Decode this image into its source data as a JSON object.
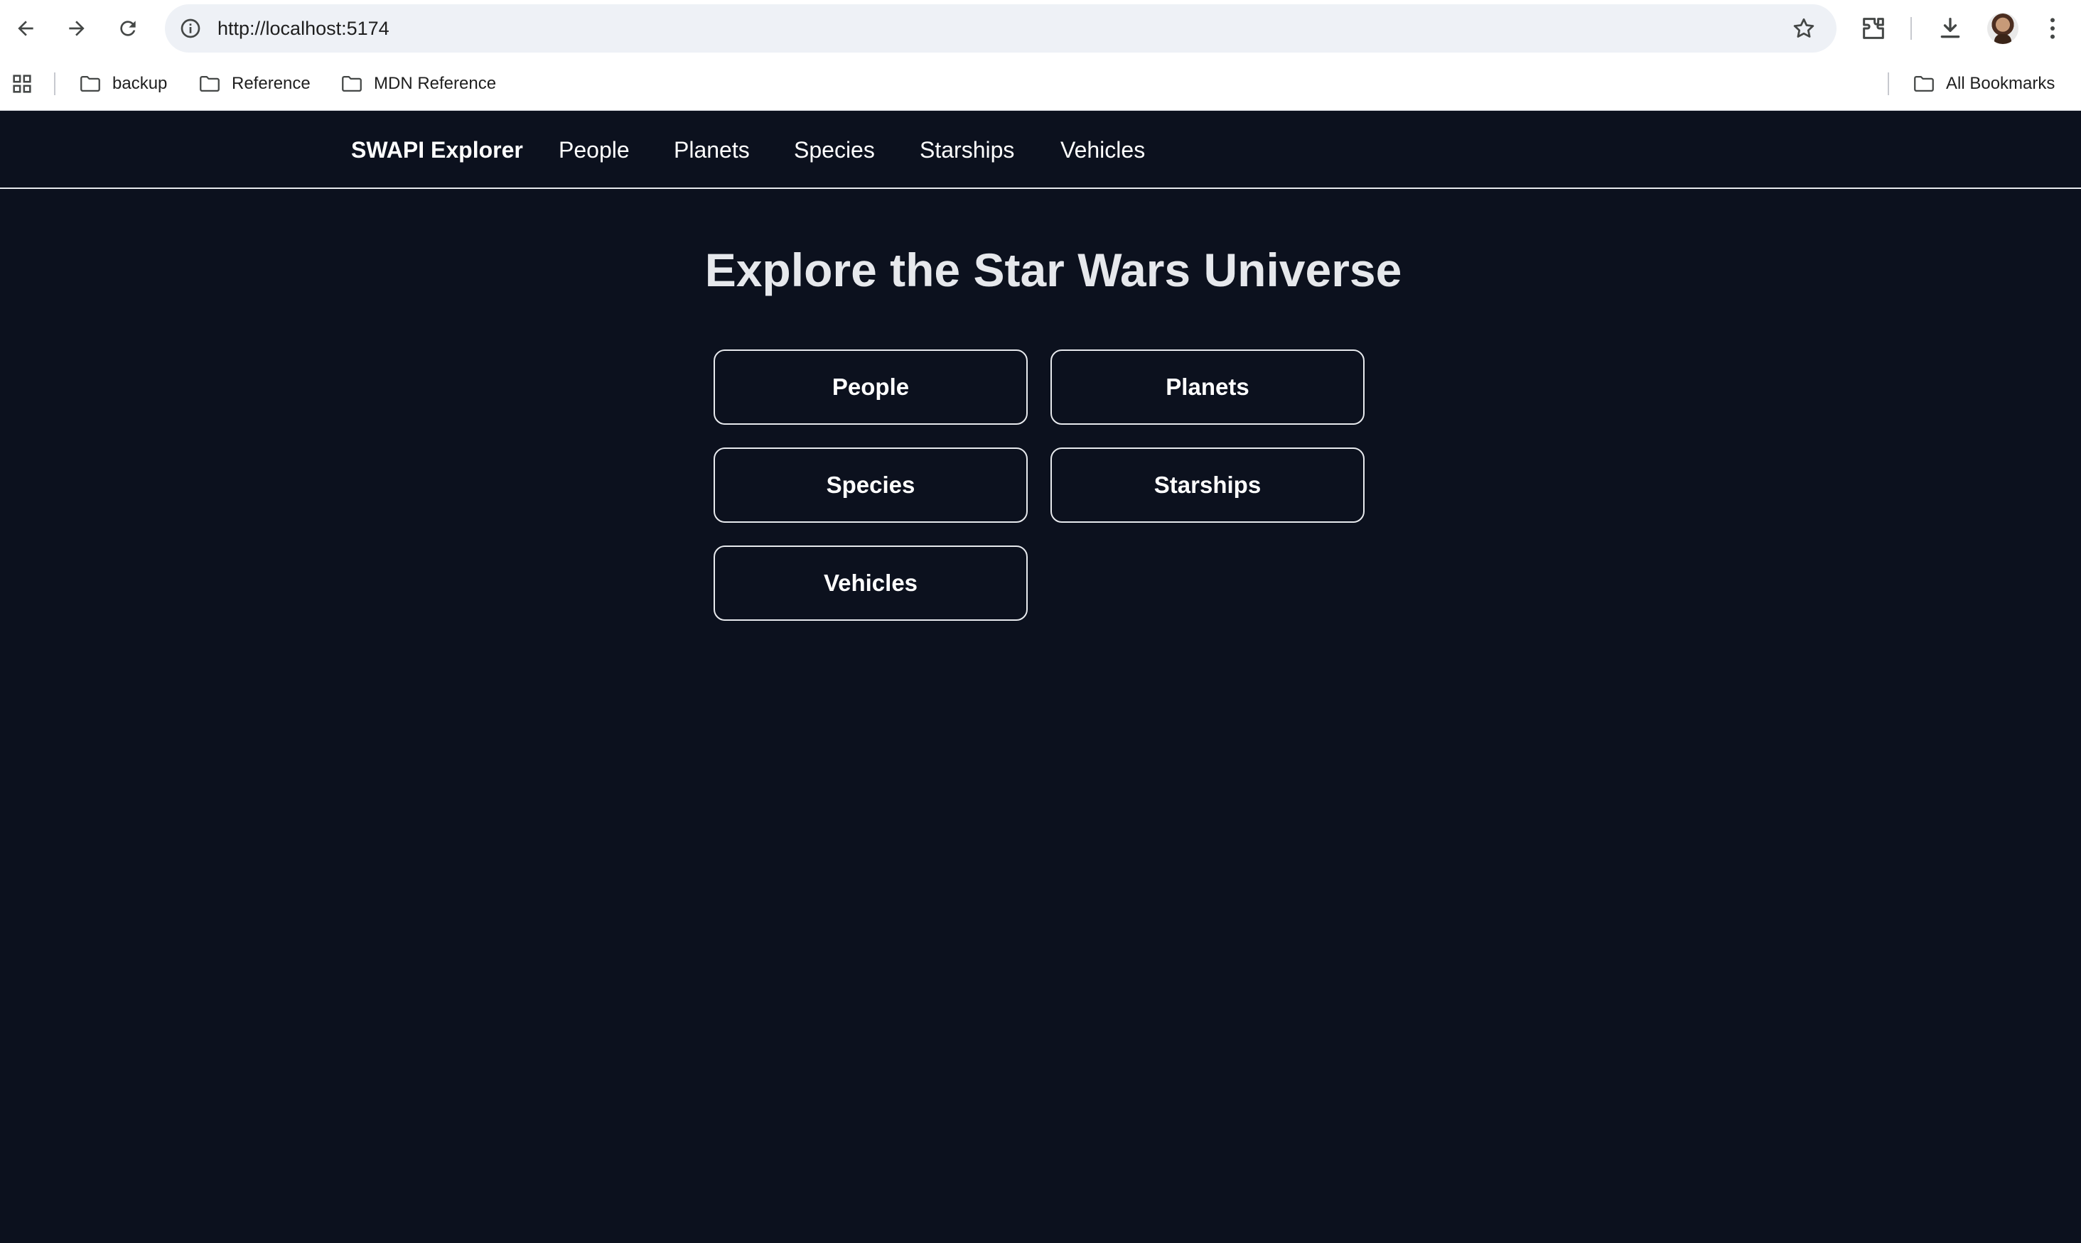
{
  "browser": {
    "url": "http://localhost:5174",
    "bookmarks": [
      {
        "label": "backup"
      },
      {
        "label": "Reference"
      },
      {
        "label": "MDN Reference"
      }
    ],
    "all_bookmarks_label": "All Bookmarks"
  },
  "header": {
    "brand": "SWAPI Explorer",
    "nav": [
      {
        "label": "People"
      },
      {
        "label": "Planets"
      },
      {
        "label": "Species"
      },
      {
        "label": "Starships"
      },
      {
        "label": "Vehicles"
      }
    ]
  },
  "main": {
    "title": "Explore the Star Wars Universe",
    "cards": [
      {
        "label": "People"
      },
      {
        "label": "Planets"
      },
      {
        "label": "Species"
      },
      {
        "label": "Starships"
      },
      {
        "label": "Vehicles"
      }
    ]
  },
  "colors": {
    "background": "#0c111e",
    "text": "#ffffff",
    "border": "#e8eaee"
  }
}
